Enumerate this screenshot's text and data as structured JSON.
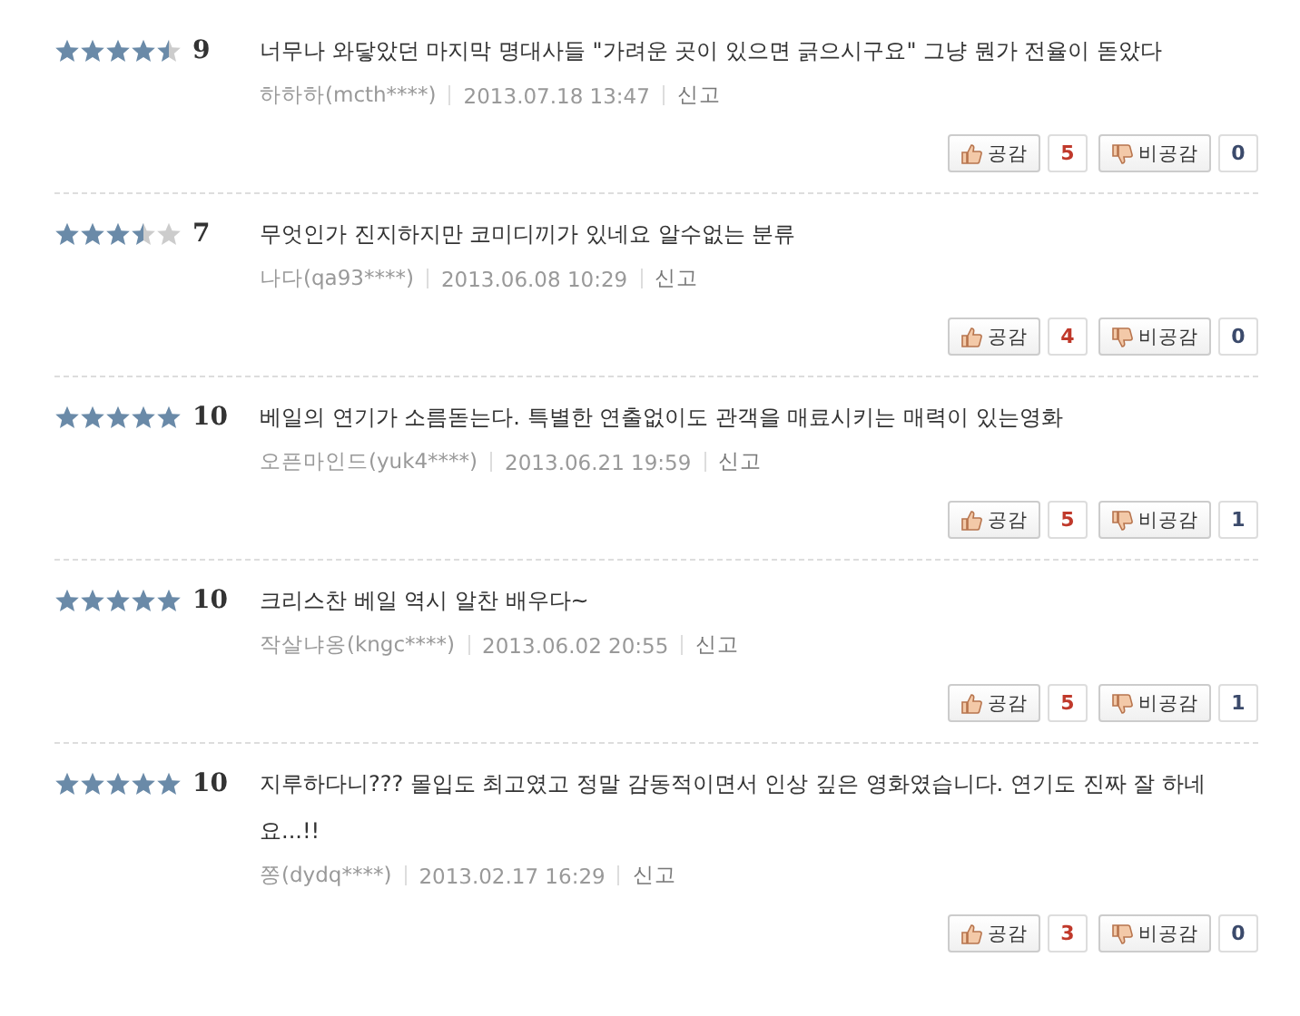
{
  "reviews": [
    {
      "stars": 4.5,
      "score": "9",
      "text": "너무나 와닿았던 마지막 명대사들 \"가려운 곳이 있으면 긁으시구요\" 그냥 뭔가 전율이 돋았다",
      "author": "하하하(mcth****)",
      "date": "2013.07.18 13:47",
      "report": "신고",
      "like_label": "공감",
      "likes": "5",
      "dislike_label": "비공감",
      "dislikes": "0"
    },
    {
      "stars": 3.5,
      "score": "7",
      "text": "무엇인가 진지하지만 코미디끼가 있네요 알수없는 분류",
      "author": "나다(qa93****)",
      "date": "2013.06.08 10:29",
      "report": "신고",
      "like_label": "공감",
      "likes": "4",
      "dislike_label": "비공감",
      "dislikes": "0"
    },
    {
      "stars": 5,
      "score": "10",
      "text": "베일의 연기가 소름돋는다. 특별한 연출없이도 관객을 매료시키는 매력이 있는영화",
      "author": "오픈마인드(yuk4****)",
      "date": "2013.06.21 19:59",
      "report": "신고",
      "like_label": "공감",
      "likes": "5",
      "dislike_label": "비공감",
      "dislikes": "1"
    },
    {
      "stars": 5,
      "score": "10",
      "text": "크리스찬 베일 역시 알찬 배우다~",
      "author": "작살냐옹(kngc****)",
      "date": "2013.06.02 20:55",
      "report": "신고",
      "like_label": "공감",
      "likes": "5",
      "dislike_label": "비공감",
      "dislikes": "1"
    },
    {
      "stars": 5,
      "score": "10",
      "text": "지루하다니??? 몰입도 최고였고 정말 감동적이면서 인상 깊은 영화였습니다. 연기도 진짜 잘 하네요...!!",
      "author": "쫑(dydq****)",
      "date": "2013.02.17 16:29",
      "report": "신고",
      "like_label": "공감",
      "likes": "3",
      "dislike_label": "비공감",
      "dislikes": "0"
    }
  ]
}
